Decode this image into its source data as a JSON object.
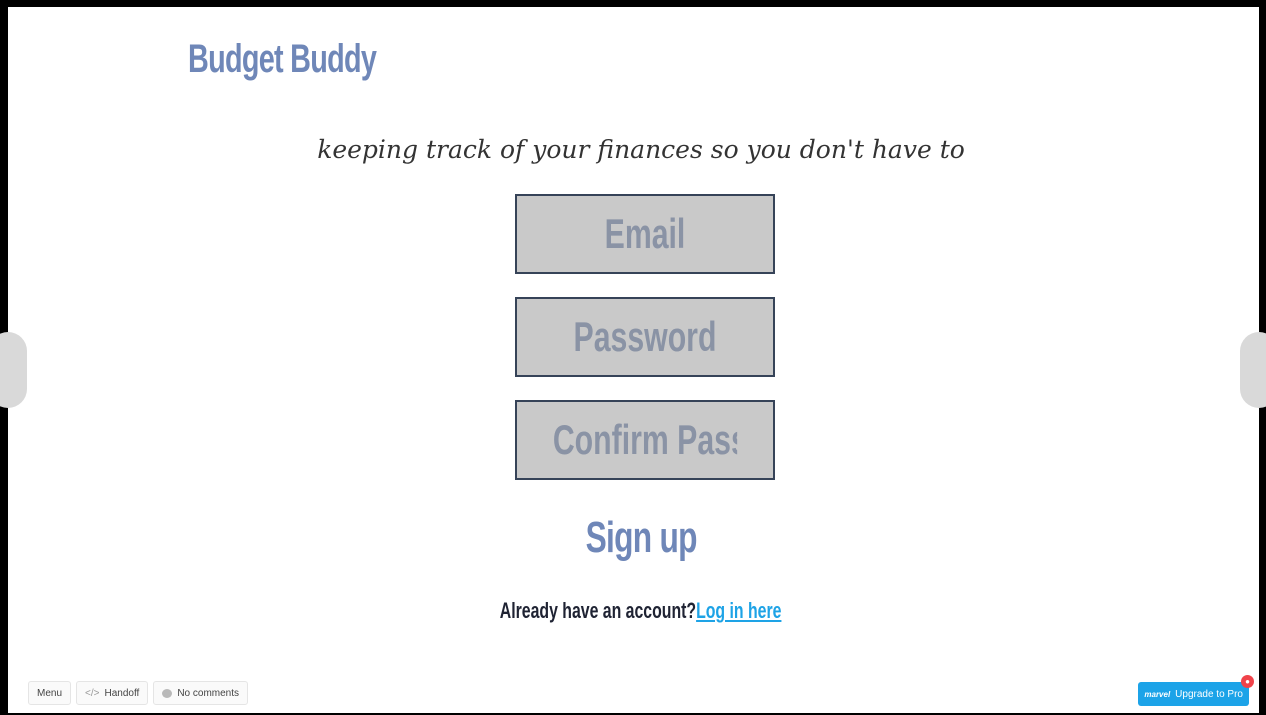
{
  "app": {
    "title": "Budget Buddy",
    "tagline": "keeping track of your finances so you don't have to"
  },
  "form": {
    "email_placeholder": "Email",
    "password_placeholder": "Password",
    "confirm_placeholder": "Confirm Password",
    "signup_label": "Sign up",
    "login_prompt": "Already have an account?",
    "login_link": "Log in here"
  },
  "toolbar": {
    "menu_label": "Menu",
    "handoff_code": "</>",
    "handoff_label": "Handoff",
    "comments_label": "No comments",
    "upgrade_logo": "marvel",
    "upgrade_label": "Upgrade to Pro",
    "badge": "●"
  },
  "colors": {
    "accent": "#6f87b8",
    "link": "#1ea3e6",
    "field_bg": "#c9c9c9",
    "field_border": "#364358",
    "upgrade_bg": "#1ca3e8"
  }
}
